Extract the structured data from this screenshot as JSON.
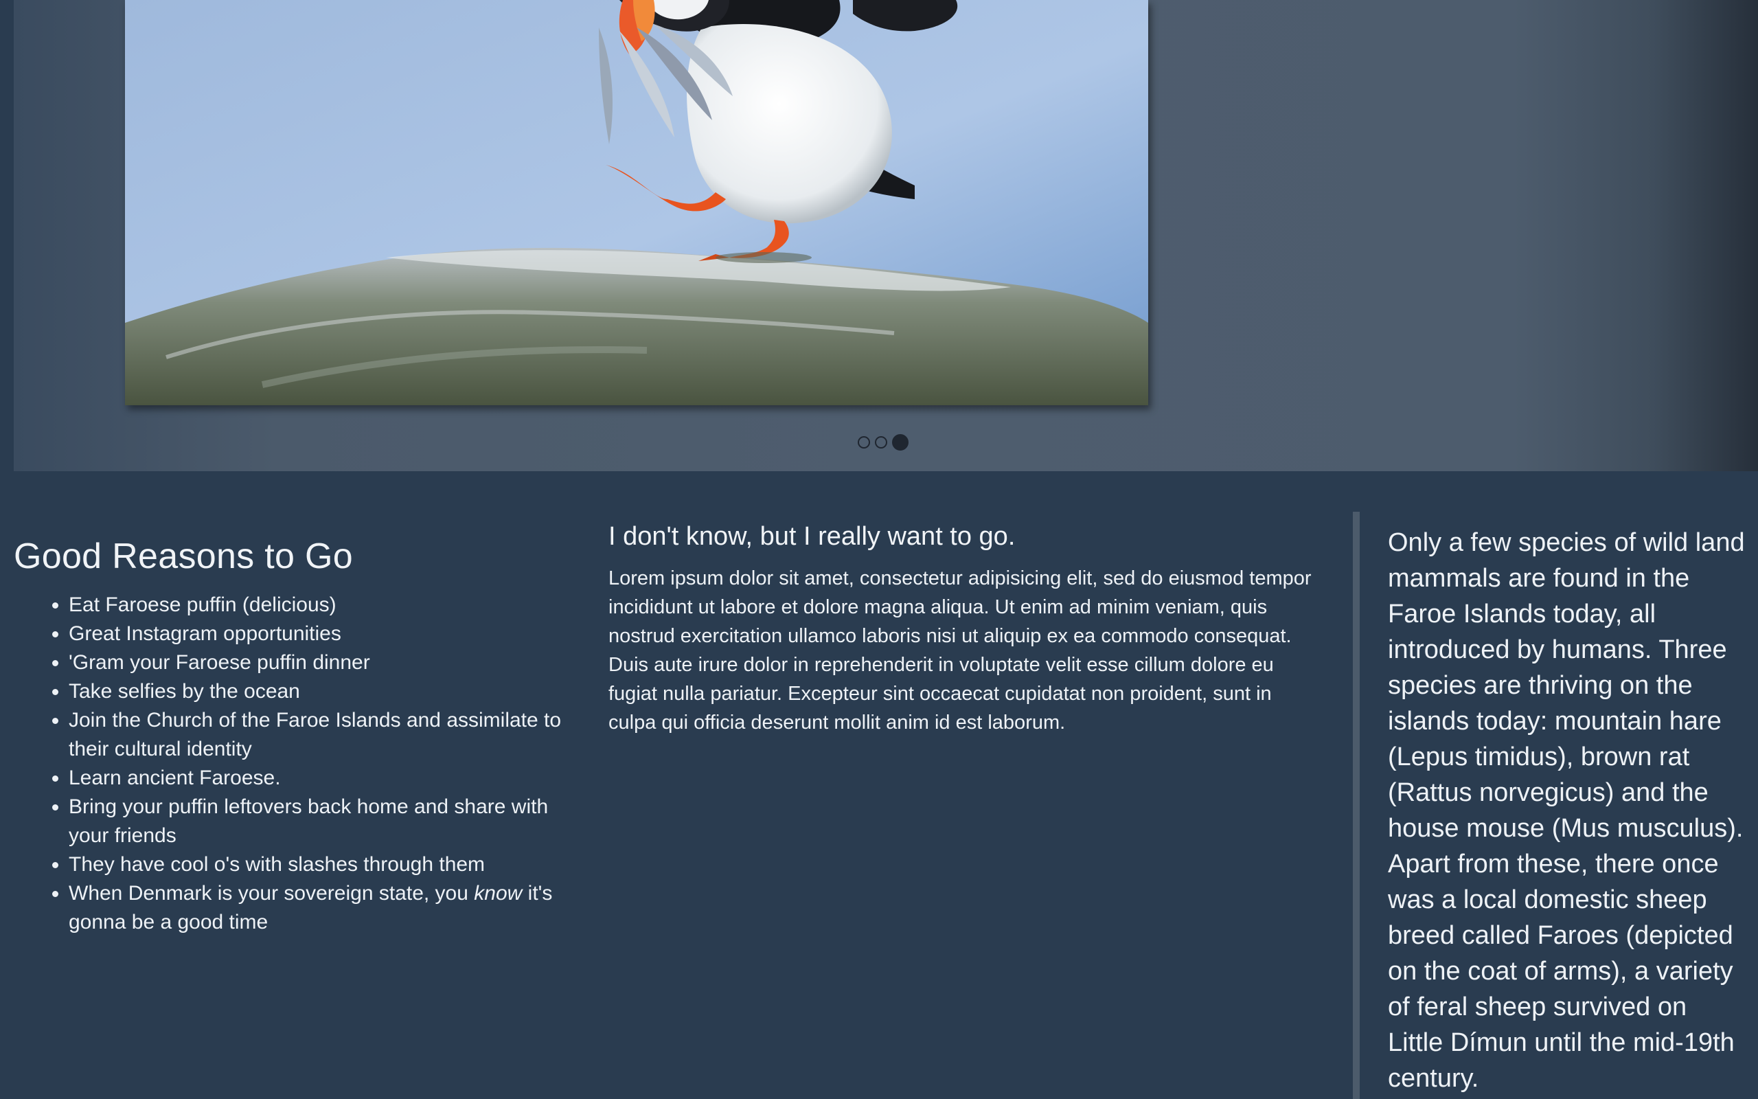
{
  "carousel": {
    "image_alt": "Atlantic puffin standing on a rock holding fish in its beak",
    "indicators": [
      {
        "label": "Slide 1",
        "active": false
      },
      {
        "label": "Slide 2",
        "active": false
      },
      {
        "label": "Slide 3",
        "active": true
      }
    ]
  },
  "reasons": {
    "heading": "Good Reasons to Go",
    "items": [
      "Eat Faroese puffin (delicious)",
      "Great Instagram opportunities",
      "'Gram your Faroese puffin dinner",
      "Take selfies by the ocean",
      "Join the Church of the Faroe Islands and assimilate to their cultural identity",
      "Learn ancient Faroese.",
      "Bring your puffin leftovers back home and share with your friends",
      "They have cool o's with slashes through them"
    ],
    "last_item": {
      "before": "When Denmark is your sovereign state, you ",
      "emphasis": "know",
      "after": " it's gonna be a good time"
    }
  },
  "middle": {
    "heading": "I don't know, but I really want to go.",
    "body": "Lorem ipsum dolor sit amet, consectetur adipisicing elit, sed do eiusmod tempor incididunt ut labore et dolore magna aliqua. Ut enim ad minim veniam, quis nostrud exercitation ullamco laboris nisi ut aliquip ex ea commodo consequat. Duis aute irure dolor in reprehenderit in voluptate velit esse cillum dolore eu fugiat nulla pariatur. Excepteur sint occaecat cupidatat non proident, sunt in culpa qui officia deserunt mollit anim id est laborum."
  },
  "aside": {
    "text": "Only a few species of wild land mammals are found in the Faroe Islands today, all introduced by humans. Three species are thriving on the islands today: mountain hare (Lepus timidus), brown rat (Rattus norvegicus) and the house mouse (Mus musculus). Apart from these, there once was a local domestic sheep breed called Faroes (depicted on the coat of arms), a variety of feral sheep survived on Little Dímun until the mid-19th century."
  },
  "colors": {
    "background": "#2a3c50",
    "carousel_band": "#4e5d6e",
    "divider": "#4c5b6b",
    "indicator": "#1f2630",
    "text": "#eef2f6"
  }
}
